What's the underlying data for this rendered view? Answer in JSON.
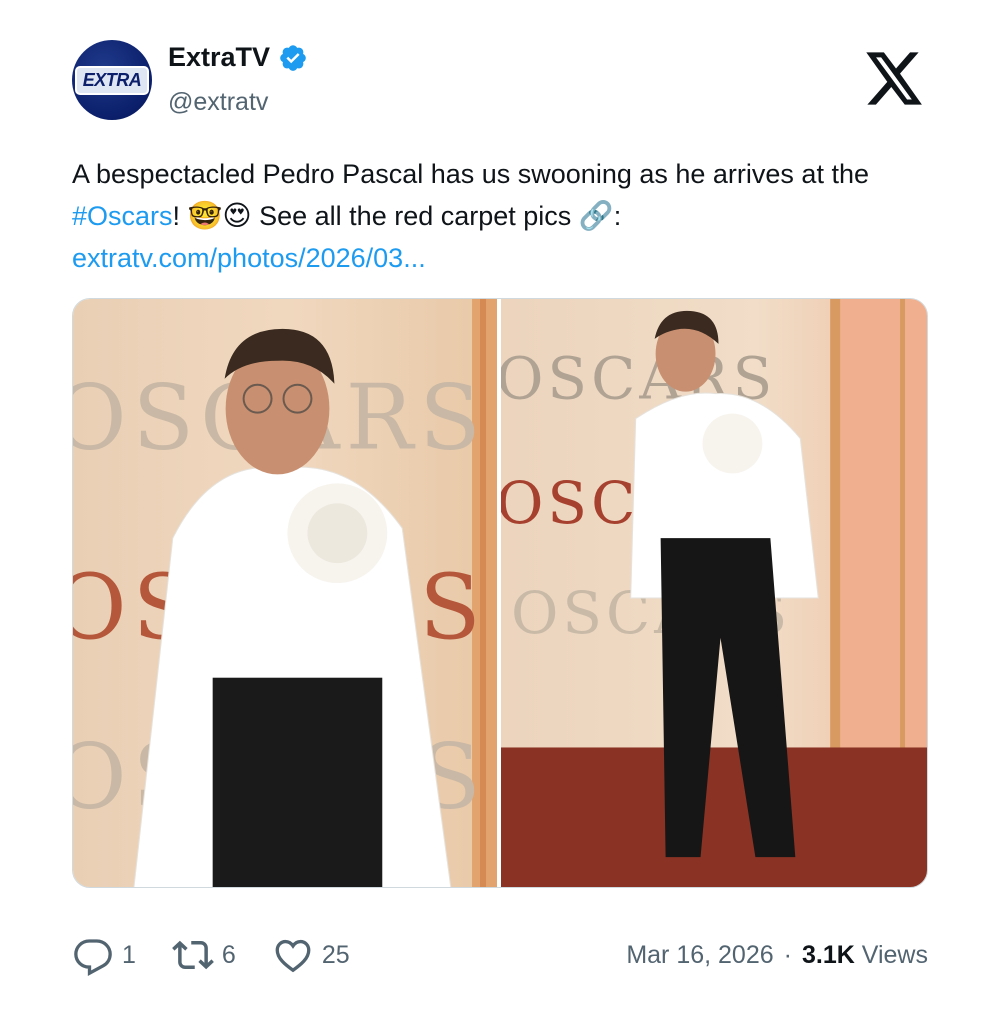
{
  "author": {
    "display_name": "ExtraTV",
    "handle": "@extratv",
    "avatar_text": "EXTRA",
    "verified": true
  },
  "tweet": {
    "text_part1": "A bespectacled Pedro Pascal has us swooning as he arrives at the ",
    "hashtag": "#Oscars",
    "text_part2": "! ",
    "emoji1": "🤓",
    "emoji2": "😍",
    "text_part3": " See all the red carpet pics ",
    "emoji3": "🔗",
    "text_part4": ":",
    "link": "extratv.com/photos/2026/03..."
  },
  "media": {
    "photos": [
      {
        "label": "Pedro Pascal at the Oscars, close-up"
      },
      {
        "label": "Pedro Pascal at the Oscars, full length"
      }
    ],
    "backdrop_text": "OSCARS"
  },
  "engagement": {
    "replies": "1",
    "retweets": "6",
    "likes": "25"
  },
  "meta": {
    "date": "Mar 16, 2026",
    "separator": "·",
    "views_count": "3.1K",
    "views_label": "Views"
  },
  "colors": {
    "accent": "#1d9bf0",
    "text": "#0f1419",
    "muted": "#536471",
    "verified": "#1d9bf0"
  },
  "icons": [
    "verified-icon",
    "x-logo-icon",
    "reply-icon",
    "retweet-icon",
    "like-icon"
  ]
}
